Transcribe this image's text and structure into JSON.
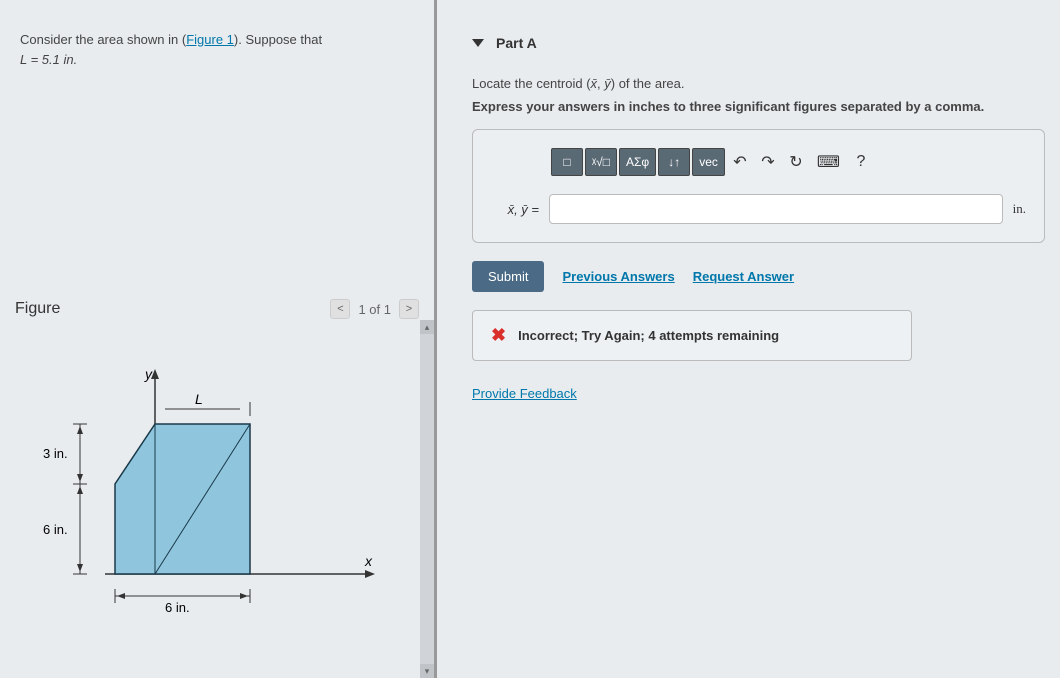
{
  "problem": {
    "text_prefix": "Consider the area shown in (",
    "figure_link": "Figure 1",
    "text_suffix": "). Suppose that",
    "equation": "L = 5.1 in."
  },
  "figure": {
    "title": "Figure",
    "nav_prev": "<",
    "nav_label": "1 of 1",
    "nav_next": ">",
    "labels": {
      "y": "y",
      "x": "x",
      "L": "L",
      "dim_3in": "3 in.",
      "dim_6in_v": "6 in.",
      "dim_6in_h": "6 in."
    }
  },
  "part": {
    "label": "Part A",
    "instruction_prefix": "Locate the centroid (",
    "xbar": "x̄",
    "comma": ", ",
    "ybar": "ȳ",
    "instruction_suffix": ") of the area.",
    "express": "Express your answers in inches to three significant figures separated by a comma."
  },
  "toolbar": {
    "template": "□",
    "root": "ᵡ√□",
    "greek": "ΑΣφ",
    "arrows": "↓↑",
    "vec": "vec",
    "undo": "↶",
    "redo": "↷",
    "reset": "↻",
    "keyboard": "⌨",
    "help": "?"
  },
  "input": {
    "label": "x̄, ȳ =",
    "unit": "in.",
    "value": ""
  },
  "actions": {
    "submit": "Submit",
    "previous": "Previous Answers",
    "request": "Request Answer"
  },
  "feedback": {
    "icon": "✖",
    "text": "Incorrect; Try Again; 4 attempts remaining"
  },
  "provide_feedback": "Provide Feedback"
}
